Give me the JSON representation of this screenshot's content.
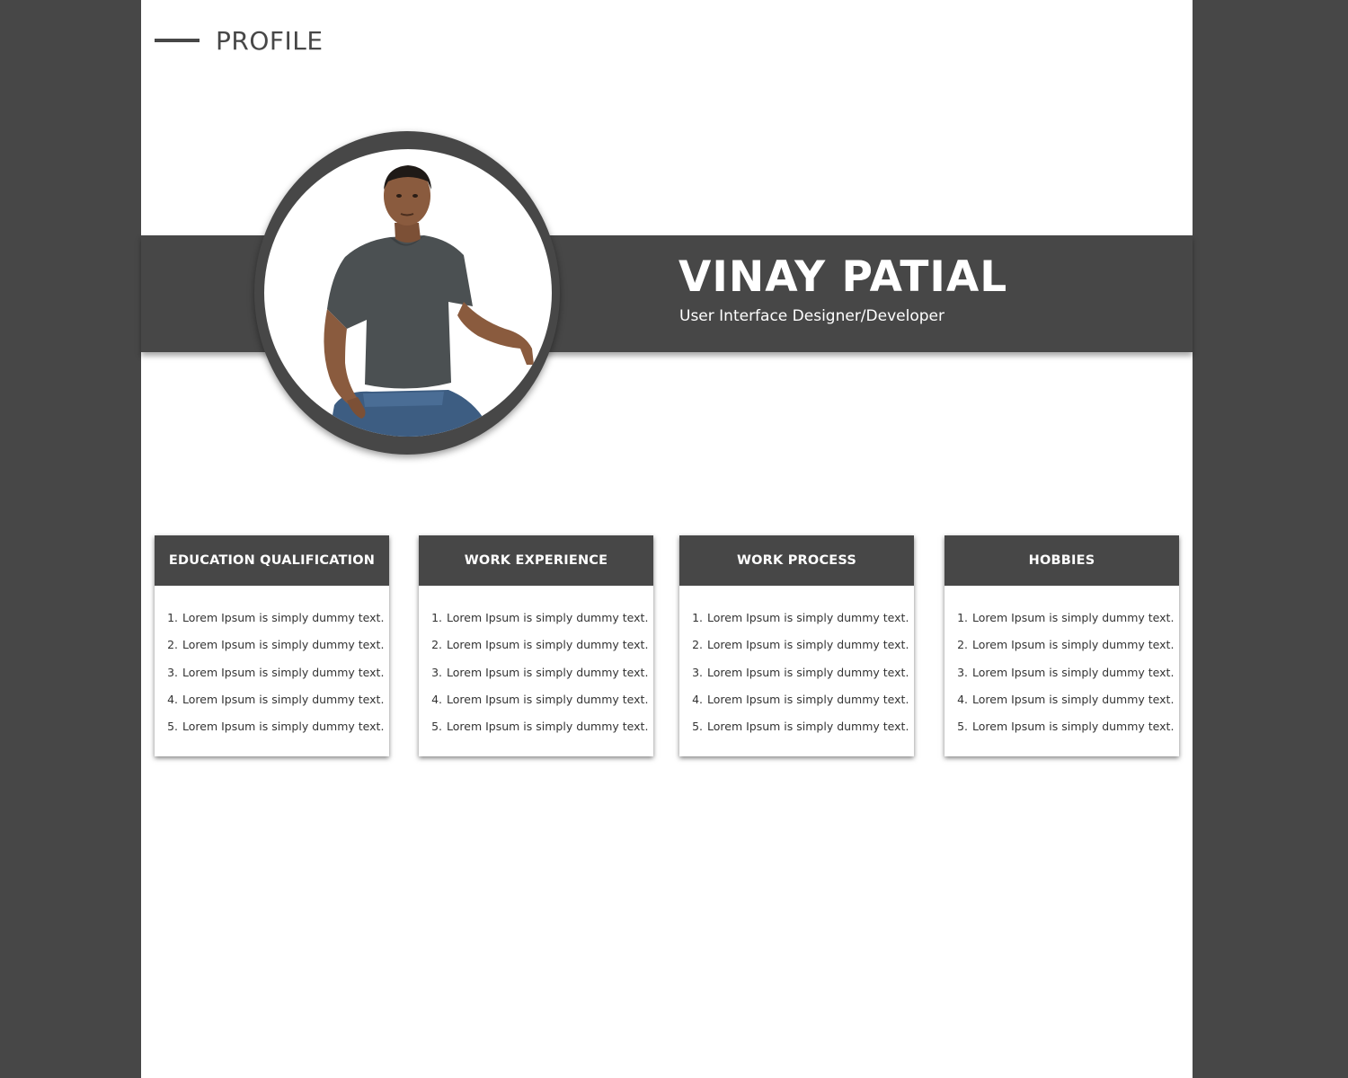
{
  "header": {
    "title": "PROFILE"
  },
  "profile": {
    "name": "VINAY PATIAL",
    "role": "User Interface Designer/Developer"
  },
  "cards": [
    {
      "title": "EDUCATION QUALIFICATION",
      "items": [
        "Lorem Ipsum is simply dummy text.",
        "Lorem Ipsum is simply dummy text.",
        "Lorem Ipsum is simply dummy text.",
        "Lorem Ipsum is simply dummy text.",
        "Lorem Ipsum is simply dummy text."
      ]
    },
    {
      "title": "WORK EXPERIENCE",
      "items": [
        "Lorem Ipsum is simply dummy text.",
        "Lorem Ipsum is simply dummy text.",
        "Lorem Ipsum is simply dummy text.",
        "Lorem Ipsum is simply dummy text.",
        "Lorem Ipsum is simply dummy text."
      ]
    },
    {
      "title": "WORK PROCESS",
      "items": [
        "Lorem Ipsum is simply dummy text.",
        "Lorem Ipsum is simply dummy text.",
        "Lorem Ipsum is simply dummy text.",
        "Lorem Ipsum is simply dummy text.",
        "Lorem Ipsum is simply dummy text."
      ]
    },
    {
      "title": "HOBBIES",
      "items": [
        "Lorem Ipsum is simply dummy text.",
        "Lorem Ipsum is simply dummy text.",
        "Lorem Ipsum is simply dummy text.",
        "Lorem Ipsum is simply dummy text.",
        "Lorem Ipsum is simply dummy text."
      ]
    }
  ],
  "colors": {
    "background": "#474747",
    "page": "#ffffff",
    "accent": "#474747"
  }
}
